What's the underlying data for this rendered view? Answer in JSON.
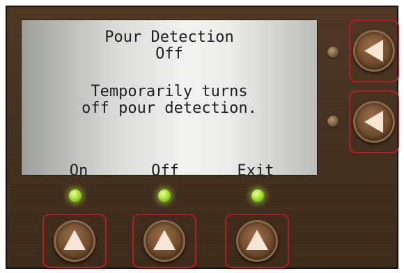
{
  "screen": {
    "title": "Pour Detection",
    "value": "Off",
    "description_line1": "Temporarily turns",
    "description_line2": "off pour detection."
  },
  "softkeys": [
    {
      "label": "On"
    },
    {
      "label": "Off"
    },
    {
      "label": "Exit"
    }
  ],
  "indicators": {
    "led_color": "#a8e23a",
    "frame_color": "#b01e24"
  },
  "side_buttons": [
    {
      "icon": "arrow-left-icon"
    },
    {
      "icon": "arrow-left-icon"
    }
  ],
  "bottom_buttons": [
    {
      "icon": "arrow-up-icon"
    },
    {
      "icon": "arrow-up-icon"
    },
    {
      "icon": "arrow-up-icon"
    }
  ]
}
